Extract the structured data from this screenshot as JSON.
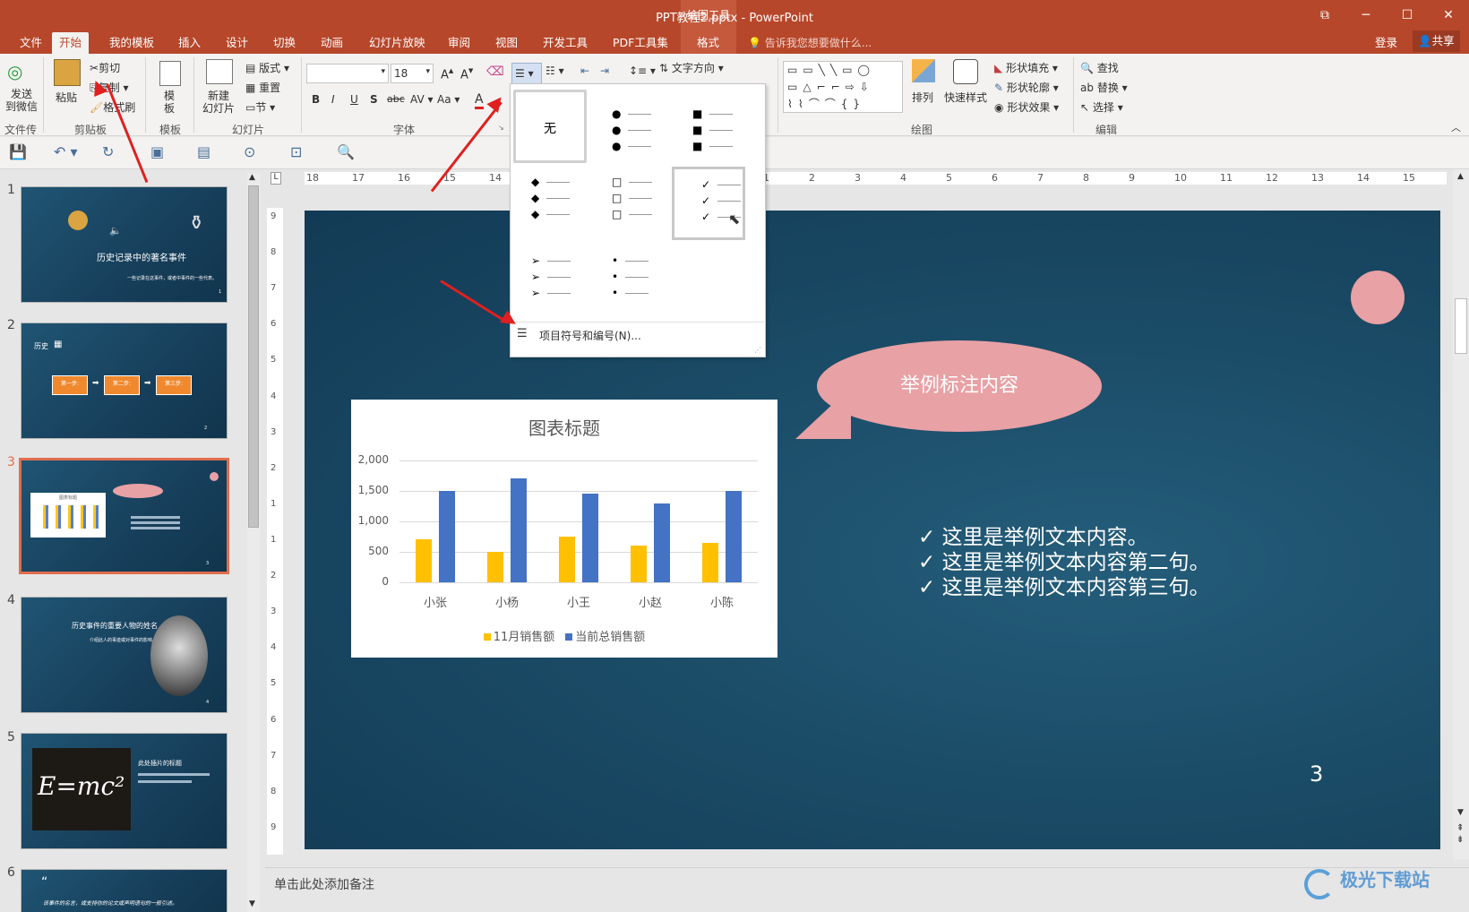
{
  "window": {
    "title": "PPT教程2.pptx - PowerPoint",
    "context_group": "绘图工具",
    "login": "登录",
    "share": "共享",
    "tell_me": "告诉我您想要做什么..."
  },
  "tabs": [
    "文件",
    "开始",
    "我的模板",
    "插入",
    "设计",
    "切换",
    "动画",
    "幻灯片放映",
    "审阅",
    "视图",
    "开发工具",
    "PDF工具集",
    "格式"
  ],
  "active_tab": "开始",
  "ribbon": {
    "send_label": "发送\n到微信",
    "file_transfer_group": "文件传输",
    "paste": "粘贴",
    "cut": "剪切",
    "copy": "复制",
    "format_painter": "格式刷",
    "clipboard_group": "剪贴板",
    "template": "模\n板",
    "template_group": "模板",
    "new_slide": "新建\n幻灯片",
    "layout": "版式",
    "reset": "重置",
    "section": "节",
    "slides_group": "幻灯片",
    "font_size": "18",
    "font_group": "字体",
    "text_direction": "文字方向",
    "drawing_group": "绘图",
    "arrange": "排列",
    "quick_styles": "快速样式",
    "shape_fill": "形状填充",
    "shape_outline": "形状轮廓",
    "shape_effects": "形状效果",
    "find": "查找",
    "replace": "替换",
    "select": "选择",
    "editing_group": "编辑"
  },
  "bullets_dropdown": {
    "none_label": "无",
    "footer": "项目符号和编号(N)...",
    "glyphs": [
      "●",
      "■",
      "◆",
      "□",
      "✓",
      "➢",
      "•"
    ]
  },
  "rulers": {
    "h_labels": [
      "18",
      "17",
      "16",
      "15",
      "14",
      "13",
      "4",
      "3",
      "2",
      "1",
      "1",
      "2",
      "3",
      "4",
      "5",
      "6",
      "7",
      "8",
      "9",
      "10",
      "11",
      "12",
      "13",
      "14",
      "15"
    ],
    "v_labels": [
      "9",
      "8",
      "7",
      "6",
      "5",
      "4",
      "3",
      "2",
      "1",
      "1",
      "2",
      "3",
      "4",
      "5",
      "6",
      "7",
      "8",
      "9"
    ]
  },
  "thumbnails": [
    {
      "num": "1",
      "title": "历史记录中的著名事件",
      "subtitle": "一些记录在这事件，或者中事件的一些代表。"
    },
    {
      "num": "2",
      "title": "历史",
      "steps": [
        "第一步:",
        "第二步:",
        "第三步:"
      ]
    },
    {
      "num": "3",
      "title": "图表标题"
    },
    {
      "num": "4",
      "title": "历史事件的重要人物的姓名",
      "subtitle": "介绍此人的事迹或对事件的影响。"
    },
    {
      "num": "5",
      "title": "此处插片的标题",
      "formula": "E=mc²"
    },
    {
      "num": "6",
      "title": "该事件的名言，或支持你的论文或声明语句的一般引述。"
    }
  ],
  "slide": {
    "callout": "举例标注内容",
    "bullets": [
      "这里是举例文本内容。",
      "这里是举例文本内容第二句。",
      "这里是举例文本内容第三句。"
    ],
    "bullet_glyph": "✓",
    "page_number": "3",
    "notes_placeholder": "单击此处添加备注"
  },
  "chart_data": {
    "type": "bar",
    "title": "图表标题",
    "categories": [
      "小张",
      "小杨",
      "小王",
      "小赵",
      "小陈"
    ],
    "series": [
      {
        "name": "11月销售额",
        "color": "#ffc000",
        "values": [
          700,
          500,
          750,
          600,
          640
        ]
      },
      {
        "name": "当前总销售额",
        "color": "#4472c4",
        "values": [
          1500,
          1700,
          1460,
          1300,
          1500
        ]
      }
    ],
    "ylim": [
      0,
      2000
    ],
    "yticks": [
      "2,000",
      "1,500",
      "1,000",
      "500",
      "0"
    ],
    "legend": "bottom",
    "grid": true
  },
  "watermark": "极光下载站"
}
